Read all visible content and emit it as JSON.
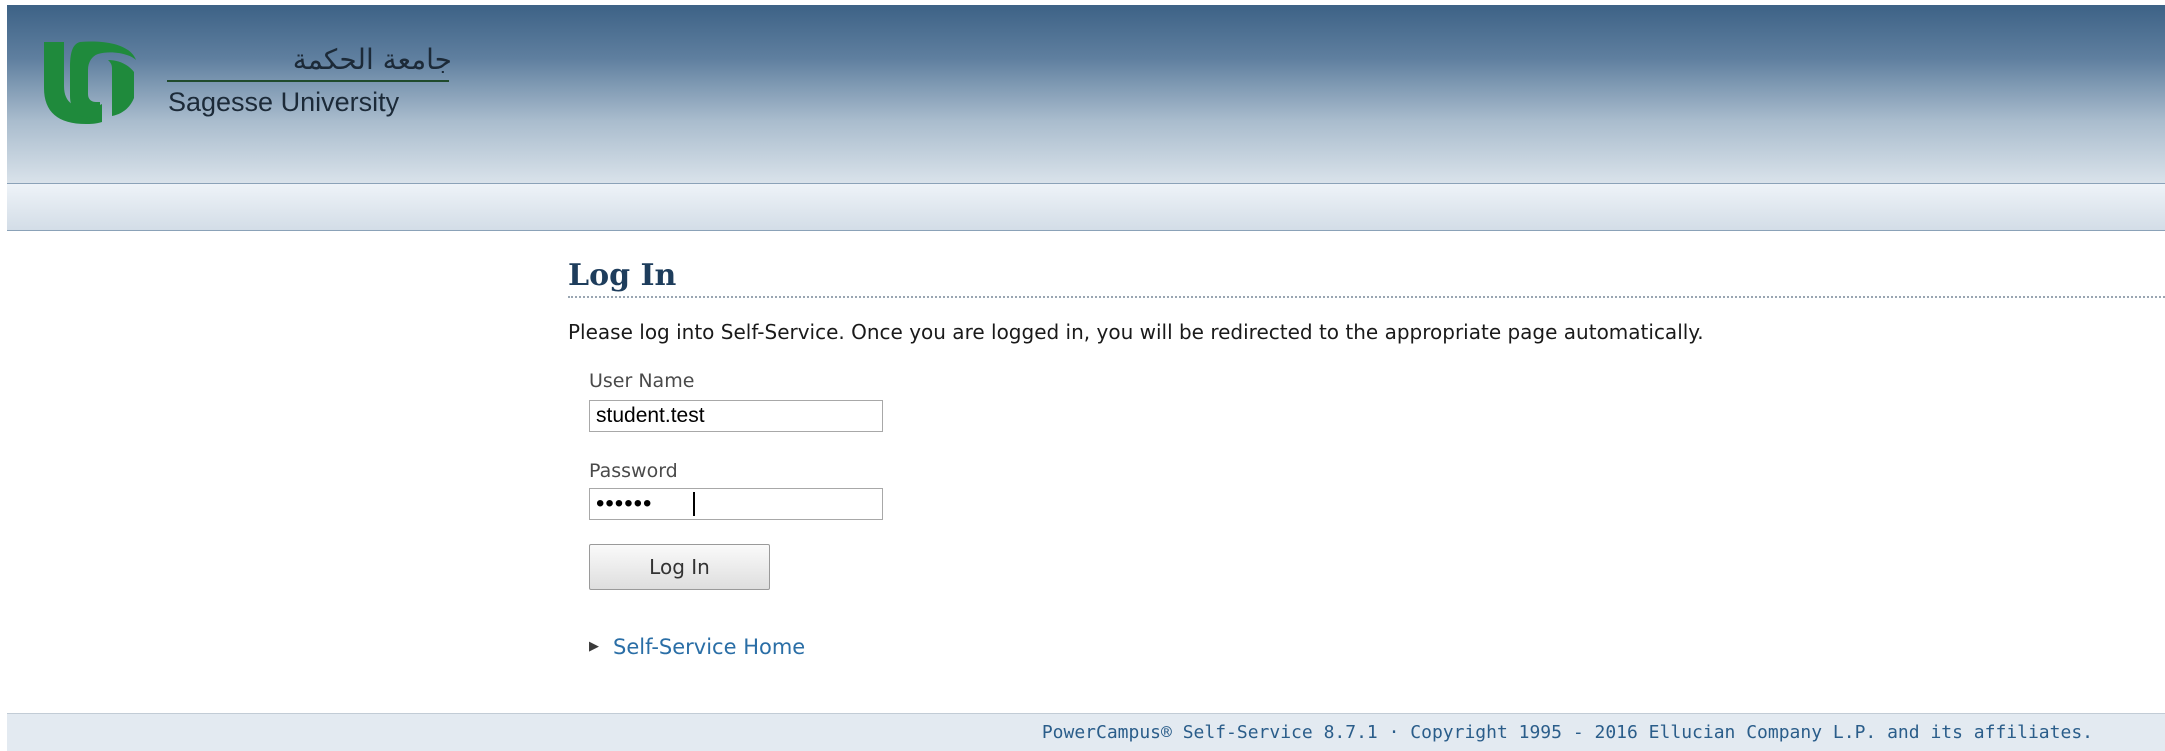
{
  "header": {
    "logo_arabic": "جامعة الحكمة",
    "logo_english": "Sagesse University",
    "logo_icon": "university-logo-icon",
    "logo_color": "#1f8a3c"
  },
  "main": {
    "title": "Log In",
    "intro": "Please log into Self-Service. Once you are logged in, you will be redirected to the appropriate page automatically.",
    "username_label": "User Name",
    "username_value": "student.test",
    "password_label": "Password",
    "password_value": "••••••",
    "login_button": "Log In",
    "home_link": "Self-Service Home",
    "home_link_icon": "triangle-right-icon"
  },
  "footer": {
    "text": "PowerCampus® Self-Service 8.7.1 · Copyright 1995 - 2016 Ellucian Company L.P. and its affiliates."
  },
  "colors": {
    "header_dark": "#3d6286",
    "title": "#1e3d5c",
    "link": "#2a6ea6",
    "footer_text": "#2a5d8a"
  }
}
